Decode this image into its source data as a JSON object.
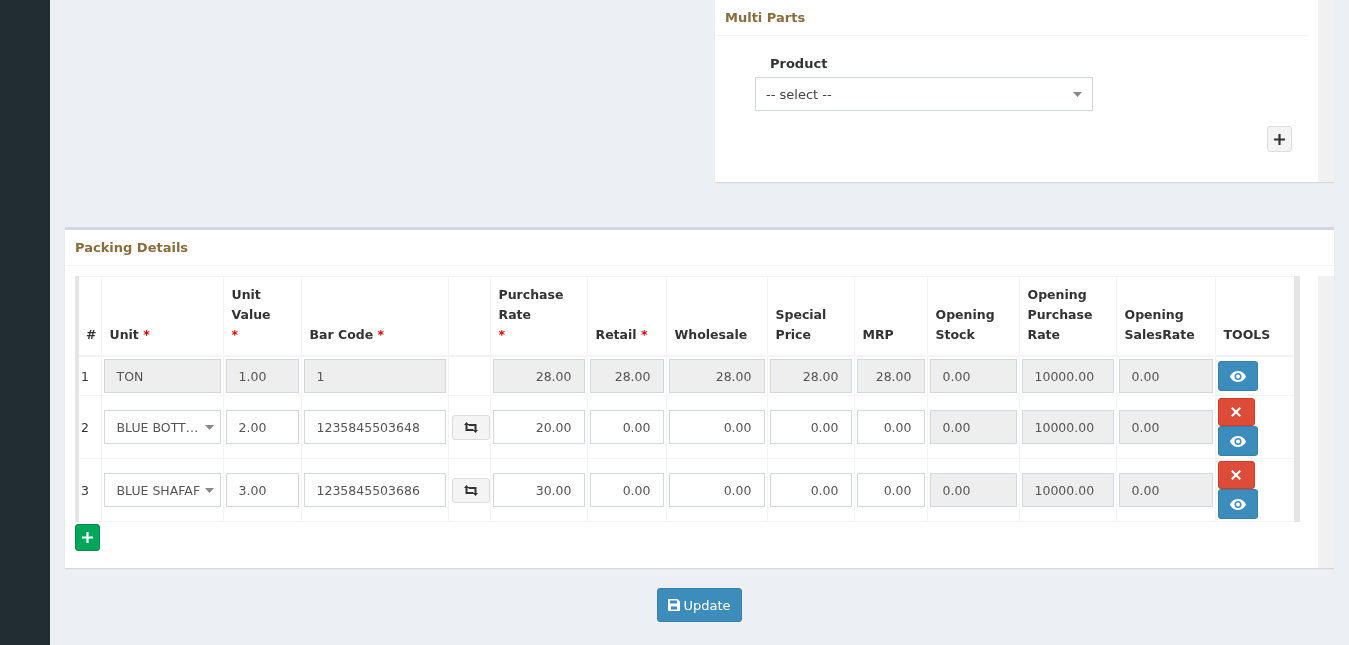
{
  "multi_parts": {
    "title": "Multi Parts",
    "product_label": "Product",
    "product_select": {
      "value": "-- select --"
    }
  },
  "packing_details": {
    "title": "Packing Details",
    "columns": [
      {
        "label": "#"
      },
      {
        "label": "Unit",
        "required_mark": "*"
      },
      {
        "label": "Unit Value",
        "required_mark": "*"
      },
      {
        "label": "Bar Code",
        "required_mark": "*"
      },
      {},
      {
        "label": "Purchase Rate",
        "required_mark": "*"
      },
      {
        "label": "Retail",
        "required_mark": "*"
      },
      {
        "label": "Wholesale"
      },
      {
        "label": "Special Price"
      },
      {
        "label": "MRP"
      },
      {
        "label": "Opening Stock"
      },
      {
        "label": "Opening Purchase Rate"
      },
      {
        "label": "Opening SalesRate"
      },
      {
        "label": "TOOLS"
      }
    ],
    "rows": [
      {
        "cells": [
          {
            "kind": "number",
            "value": "1"
          },
          {
            "kind": "text",
            "value": "TON",
            "disabled": true
          },
          {
            "kind": "text",
            "value": "1.00",
            "disabled": true
          },
          {
            "kind": "text",
            "value": "1",
            "disabled": true
          },
          {
            "kind": "none"
          },
          {
            "kind": "text",
            "value": "28.00",
            "disabled": true
          },
          {
            "kind": "text",
            "value": "28.00",
            "disabled": true
          },
          {
            "kind": "text",
            "value": "28.00",
            "disabled": true
          },
          {
            "kind": "text",
            "value": "28.00",
            "disabled": true
          },
          {
            "kind": "text",
            "value": "28.00",
            "disabled": true
          },
          {
            "kind": "text",
            "value": "0.00",
            "disabled": true
          },
          {
            "kind": "text",
            "value": "10000.00",
            "disabled": true
          },
          {
            "kind": "text",
            "value": "0.00",
            "disabled": true
          },
          {
            "kind": "tools",
            "deletable": false
          }
        ]
      },
      {
        "cells": [
          {
            "kind": "number",
            "value": "2"
          },
          {
            "kind": "select",
            "value": "BLUE BOTT…",
            "disabled": false
          },
          {
            "kind": "text",
            "value": "2.00",
            "disabled": false
          },
          {
            "kind": "text",
            "value": "1235845503648",
            "disabled": false
          },
          {
            "kind": "swap"
          },
          {
            "kind": "text",
            "value": "20.00",
            "disabled": false
          },
          {
            "kind": "text",
            "value": "0.00",
            "disabled": false
          },
          {
            "kind": "text",
            "value": "0.00",
            "disabled": false
          },
          {
            "kind": "text",
            "value": "0.00",
            "disabled": false
          },
          {
            "kind": "text",
            "value": "0.00",
            "disabled": false
          },
          {
            "kind": "text",
            "value": "0.00",
            "disabled": true
          },
          {
            "kind": "text",
            "value": "10000.00",
            "disabled": true
          },
          {
            "kind": "text",
            "value": "0.00",
            "disabled": true
          },
          {
            "kind": "tools",
            "deletable": true
          }
        ]
      },
      {
        "cells": [
          {
            "kind": "number",
            "value": "3"
          },
          {
            "kind": "select",
            "value": "BLUE SHAFAF",
            "disabled": false
          },
          {
            "kind": "text",
            "value": "3.00",
            "disabled": false
          },
          {
            "kind": "text",
            "value": "1235845503686",
            "disabled": false
          },
          {
            "kind": "swap"
          },
          {
            "kind": "text",
            "value": "30.00",
            "disabled": false
          },
          {
            "kind": "text",
            "value": "0.00",
            "disabled": false
          },
          {
            "kind": "text",
            "value": "0.00",
            "disabled": false
          },
          {
            "kind": "text",
            "value": "0.00",
            "disabled": false
          },
          {
            "kind": "text",
            "value": "0.00",
            "disabled": false
          },
          {
            "kind": "text",
            "value": "0.00",
            "disabled": true
          },
          {
            "kind": "text",
            "value": "10000.00",
            "disabled": true
          },
          {
            "kind": "text",
            "value": "0.00",
            "disabled": true
          },
          {
            "kind": "tools",
            "deletable": true
          }
        ]
      }
    ]
  },
  "update_button": "Update"
}
